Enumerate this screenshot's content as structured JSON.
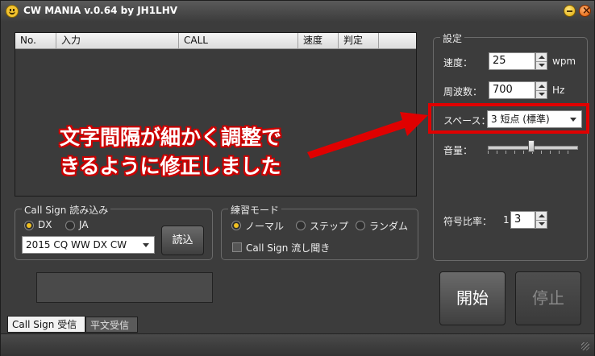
{
  "window": {
    "title": "CW MANIA v.0.64 by JH1LHV"
  },
  "list": {
    "columns": [
      "No.",
      "入力",
      "CALL",
      "速度",
      "判定"
    ]
  },
  "callsign_group": {
    "legend": "Call Sign 読み込み",
    "radio_dx": "DX",
    "radio_ja": "JA",
    "selected": "DX",
    "contest_select": "2015 CQ WW DX CW",
    "load_button": "読込"
  },
  "practice_group": {
    "legend": "練習モード",
    "modes": [
      "ノーマル",
      "ステップ",
      "ランダム"
    ],
    "selected": "ノーマル",
    "listen_checkbox": "Call Sign 流し聞き",
    "listen_checked": false
  },
  "settings": {
    "legend": "設定",
    "speed_label": "速度：",
    "speed_value": "25",
    "speed_unit": "wpm",
    "freq_label": "周波数：",
    "freq_value": "700",
    "freq_unit": "Hz",
    "space_label": "スペース：",
    "space_value": "3 短点 (標準)",
    "volume_label": "音量：",
    "volume_level_percent": 50,
    "ratio_label": "符号比率：",
    "ratio_left": "1",
    "ratio_value": "3"
  },
  "buttons": {
    "start": "開始",
    "stop": "停止"
  },
  "tabs": [
    "Call Sign 受信",
    "平文受信"
  ],
  "annotation": {
    "line1": "文字間隔が細かく調整で",
    "line2": "きるように修正しました",
    "color": "#e00000"
  }
}
